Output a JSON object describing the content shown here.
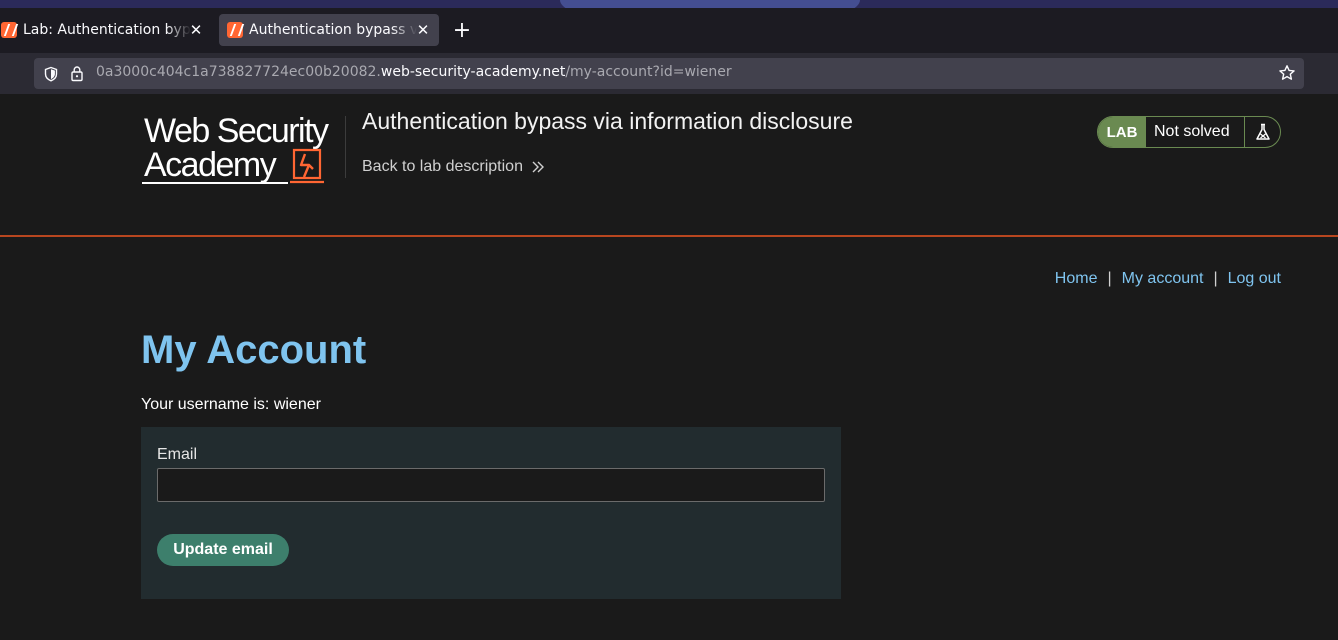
{
  "browser": {
    "tabs": [
      {
        "title": "Lab: Authentication bypass via information disclosure",
        "active": false
      },
      {
        "title": "Authentication bypass via information disclosure",
        "active": true
      }
    ],
    "new_tab_glyph": "+",
    "close_glyph": "✕",
    "url": {
      "prefix": "0a3000c404c1a738827724ec00b20082.",
      "host": "web-security-academy.net",
      "path": "/my-account?id=wiener"
    }
  },
  "header": {
    "logo_line1": "Web Security",
    "logo_line2": "Academy",
    "lab_title": "Authentication bypass via information disclosure",
    "back_link": "Back to lab description",
    "status_badge": "LAB",
    "status_text": "Not solved"
  },
  "nav": {
    "home": "Home",
    "separator": "|",
    "my_account": "My account",
    "log_out": "Log out"
  },
  "main": {
    "title": "My Account",
    "username_line": "Your username is: wiener",
    "email_label": "Email",
    "email_value": "",
    "update_button": "Update email"
  },
  "colors": {
    "accent_blue": "#7fc4ef",
    "lab_green": "#6a8a51",
    "header_rule": "#b8461f",
    "button_teal": "#3d7f6c",
    "brand_orange": "#ff6633"
  }
}
